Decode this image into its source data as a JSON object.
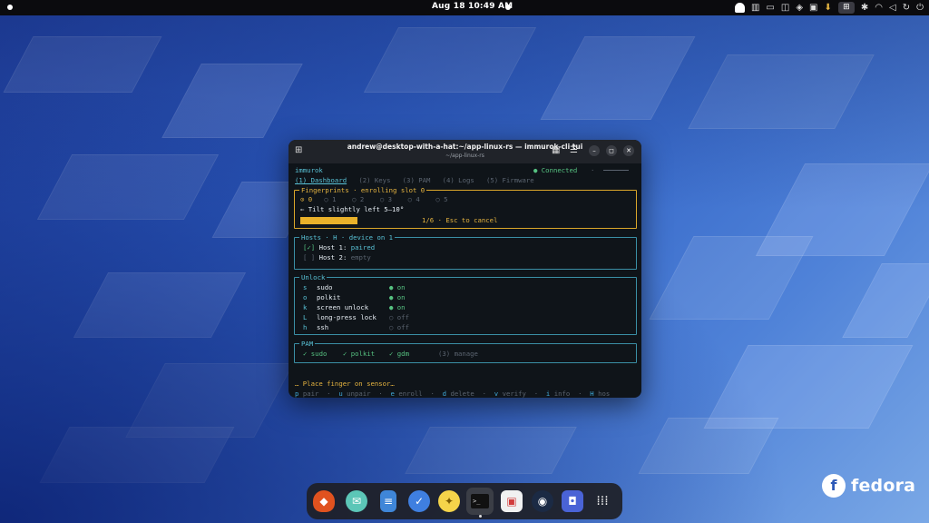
{
  "topbar": {
    "clock": "Aug 18  10:49 AM"
  },
  "window": {
    "title": "andrew@desktop-with-a-hat:~/app-linux-rs — immurok-cli tui",
    "subtitle": "~/app-linux-rs"
  },
  "tui": {
    "app_name": "immurok",
    "status": "● Connected",
    "tabs": [
      "(1) Dashboard",
      "(2) Keys",
      "(3) PAM",
      "(4) Logs",
      "(5) Firmware"
    ],
    "fingerprints": {
      "label": "Fingerprints · enrolling slot 0",
      "slots_active": "⊙ 0",
      "slots_rest": "○ 1    ○ 2    ○ 3    ○ 4    ○ 5",
      "instruction": "⇐ Tilt slightly left 5–10°",
      "progress": 0.167,
      "progress_text": "1/6 · Esc to cancel"
    },
    "hosts": {
      "label": "Hosts · H · device on 1",
      "rows": [
        {
          "check": "[✓]",
          "name": "Host 1:",
          "state": "paired"
        },
        {
          "check": "[ ]",
          "name": "Host 2:",
          "state": "empty"
        }
      ]
    },
    "unlock": {
      "label": "Unlock",
      "rows": [
        {
          "key": "s",
          "name": "sudo",
          "state": "● on"
        },
        {
          "key": "o",
          "name": "polkit",
          "state": "● on"
        },
        {
          "key": "k",
          "name": "screen unlock",
          "state": "● on"
        },
        {
          "key": "L",
          "name": "long-press lock",
          "state": "○ off"
        },
        {
          "key": "h",
          "name": "ssh",
          "state": "○ off"
        }
      ]
    },
    "pam": {
      "label": "PAM",
      "items": [
        "✓ sudo",
        "✓ polkit",
        "✓ gdm"
      ],
      "manage": "(3) manage"
    },
    "message": "… Place finger on sensor…",
    "shortcuts": [
      {
        "key": "p",
        "label": "pair"
      },
      {
        "key": "u",
        "label": "unpair"
      },
      {
        "key": "e",
        "label": "enroll"
      },
      {
        "key": "d",
        "label": "delete"
      },
      {
        "key": "v",
        "label": "verify"
      },
      {
        "key": "i",
        "label": "info"
      },
      {
        "key": "H",
        "label": "hos"
      }
    ]
  },
  "dock": {
    "apps": [
      "brave-icon",
      "mail-icon",
      "notes-icon",
      "tasks-icon",
      "bulb-icon",
      "terminal-icon",
      "software-icon",
      "steam-icon",
      "vault-icon",
      "app-grid-icon"
    ]
  },
  "brand": {
    "word": "fedora"
  }
}
